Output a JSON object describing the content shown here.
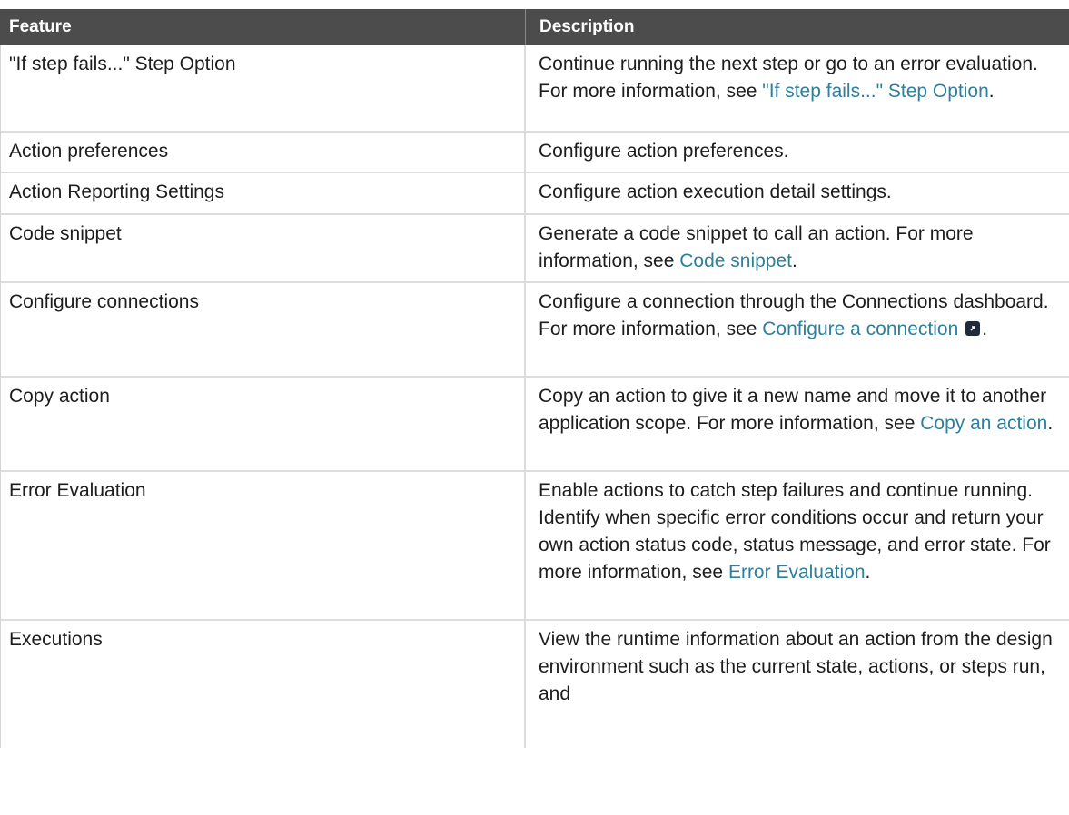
{
  "header": {
    "feature": "Feature",
    "description": "Description"
  },
  "rows": [
    {
      "feature": "\"If step fails...\" Step Option",
      "desc": "Continue running the next step or go to an error evaluation. For more information, see ",
      "link": "\"If step fails...\" Step Option",
      "tail": "."
    },
    {
      "feature": "Action preferences",
      "desc": "Configure action preferences."
    },
    {
      "feature": "Action Reporting Settings",
      "desc": "Configure action execution detail settings."
    },
    {
      "feature": "Code snippet",
      "desc": "Generate a code snippet to call an action. For more information, see ",
      "link": "Code snippet",
      "tail": "."
    },
    {
      "feature": "Configure connections",
      "desc": "Configure a connection through the Connections dashboard. For more information, see ",
      "link": "Configure a connection",
      "tail": "."
    },
    {
      "feature": "Copy action",
      "desc": "Copy an action to give it a new name and move it to another application scope. For more information, see ",
      "link": "Copy an action",
      "tail": "."
    },
    {
      "feature": "Error Evaluation",
      "desc": "Enable actions to catch step failures and continue running. Identify when specific error conditions occur and return your own action status code, status message, and error state. For more information, see ",
      "link": "Error Evaluation",
      "tail": "."
    },
    {
      "feature": "Executions",
      "desc": "View the runtime information about an action from the design environment such as the current state, actions, or steps run, and"
    }
  ],
  "colors": {
    "header_bg": "#4c4c4c",
    "link": "#2f7f9b",
    "border": "#dcdcdc"
  },
  "icons": {
    "external_link": "external-link-icon"
  }
}
